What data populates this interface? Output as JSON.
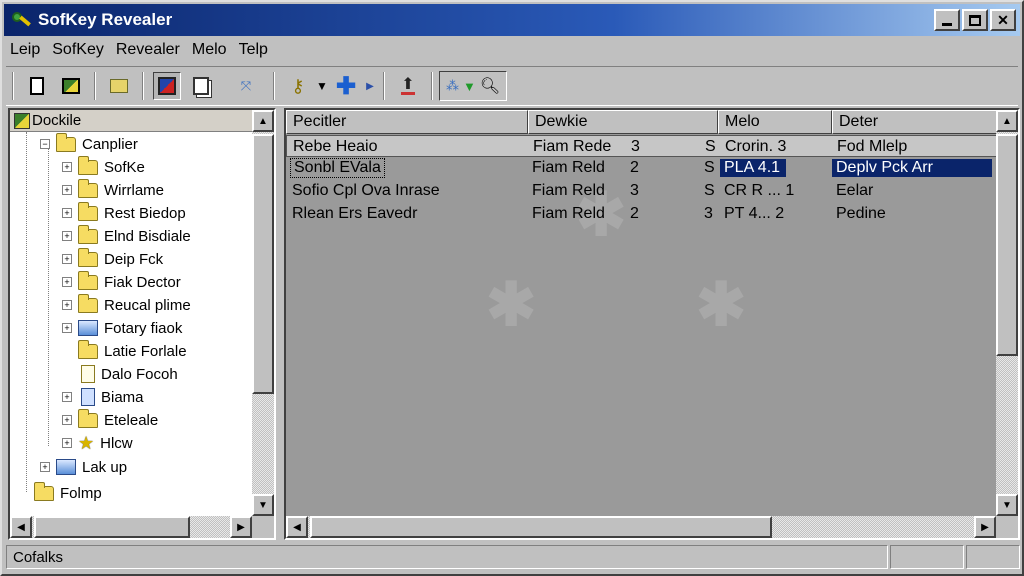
{
  "window": {
    "title": "SofKey Revealer"
  },
  "menu": [
    "Leip",
    "SofKey",
    "Revealer",
    "Melo",
    "Telp"
  ],
  "tree": {
    "header": "Dockile",
    "items": [
      {
        "label": "Canplier",
        "icon": "folder-icon"
      },
      {
        "label": "SofKe",
        "icon": "folder-icon"
      },
      {
        "label": "Wirrlame",
        "icon": "folder-icon"
      },
      {
        "label": "Rest Biedop",
        "icon": "folder-icon"
      },
      {
        "label": "Elnd Bisdiale",
        "icon": "folder-icon"
      },
      {
        "label": "Deip Fck",
        "icon": "folder-icon"
      },
      {
        "label": "Fiak Dector",
        "icon": "folder-icon"
      },
      {
        "label": "Reucal plime",
        "icon": "folder-icon"
      },
      {
        "label": "Fotary fiaok",
        "icon": "network-folder-icon"
      },
      {
        "label": "Latie Forlale",
        "icon": "folder-icon"
      },
      {
        "label": "Dalo Focoh",
        "icon": "file-icon"
      },
      {
        "label": "Biama",
        "icon": "folder-icon"
      },
      {
        "label": "Eteleale",
        "icon": "folder-icon"
      },
      {
        "label": "Hlcw",
        "icon": "star-icon"
      },
      {
        "label": "Lak up",
        "icon": "drive-icon"
      },
      {
        "label": "Folmp",
        "icon": "folder-icon"
      }
    ]
  },
  "list": {
    "columns": [
      "Pecitler",
      "Dewkie",
      "Melo",
      "Deter"
    ],
    "rows": [
      {
        "c1": "Rebe Heaio",
        "c2": "Fiam Rede",
        "n1": "3",
        "n2": "S",
        "c3": "Crorin. 3",
        "c4": "Fod Mlelp"
      },
      {
        "c1": "Sonbl EVala",
        "c2": "Fiam Reld",
        "n1": "2",
        "n2": "S",
        "c3": "PLA 4.1",
        "c4": "Deplv Pck Arr"
      },
      {
        "c1": "Sofio Cpl Ova Inrase",
        "c2": "Fiam Reld",
        "n1": "3",
        "n2": "S",
        "c3": "CR R ... 1",
        "c4": "Eelar"
      },
      {
        "c1": "Rlean Ers Eavedr",
        "c2": "Fiam Reld",
        "n1": "2",
        "n2": "3",
        "c3": "PT 4... 2",
        "c4": "Pedine"
      }
    ]
  },
  "status": {
    "text": "Cofalks"
  },
  "colors": {
    "title_start": "#0a246a",
    "selection": "#0a246a",
    "chrome": "#c0c0c0"
  }
}
